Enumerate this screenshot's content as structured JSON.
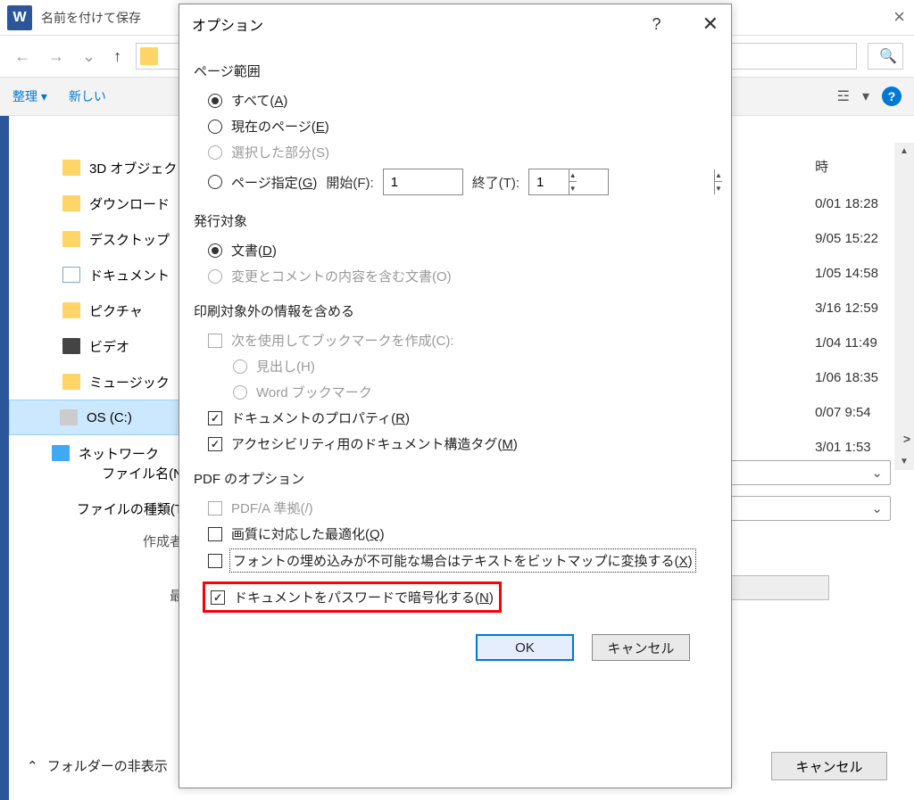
{
  "bg": {
    "title": "名前を付けて保存",
    "close_glyph": "×",
    "toolbar": {
      "organize": "整理 ▾",
      "new_folder": "新しい",
      "view_caret": "▾",
      "help": "?"
    },
    "sidebar": {
      "items": [
        {
          "label": "3D オブジェク"
        },
        {
          "label": "ダウンロード"
        },
        {
          "label": "デスクトップ"
        },
        {
          "label": "ドキュメント"
        },
        {
          "label": "ピクチャ"
        },
        {
          "label": "ビデオ"
        },
        {
          "label": "ミュージック"
        },
        {
          "label": "OS (C:)"
        },
        {
          "label": "ネットワーク"
        }
      ]
    },
    "dates_header": "時",
    "dates": [
      "0/01 18:28",
      "9/05 15:22",
      "1/05 14:58",
      "3/16 12:59",
      "1/04 11:49",
      "1/06 18:35",
      "0/07 9:54",
      "3/01 1:53"
    ],
    "form": {
      "filename_label": "ファイル名(N)",
      "filetype_label": "ファイルの種類(T)",
      "author_label": "作成者",
      "sai_label": "最"
    },
    "footer": {
      "hide_folders": "フォルダーの非表示",
      "cancel": "キャンセル"
    }
  },
  "options": {
    "title": "オプション",
    "sections": {
      "page_range": "ページ範囲",
      "publish": "発行対象",
      "include": "印刷対象外の情報を含める",
      "pdf": "PDF のオプション"
    },
    "page_range": {
      "all": {
        "pre": "すべて(",
        "u": "A",
        "post": ")"
      },
      "current": {
        "pre": "現在のページ(",
        "u": "E",
        "post": ")"
      },
      "selection": "選択した部分(S)",
      "pages": {
        "pre": "ページ指定(",
        "u": "G",
        "post": ")"
      },
      "from_label": "開始(F):",
      "to_label": "終了(T):",
      "from_value": "1",
      "to_value": "1"
    },
    "publish": {
      "document": {
        "pre": "文書(",
        "u": "D",
        "post": ")"
      },
      "with_markup": "変更とコメントの内容を含む文書(O)"
    },
    "include": {
      "bookmarks": "次を使用してブックマークを作成(C):",
      "headings": "見出し(H)",
      "word_bm": "Word ブックマーク",
      "props": {
        "pre": "ドキュメントのプロパティ(",
        "u": "R",
        "post": ")"
      },
      "a11y": {
        "pre": "アクセシビリティ用のドキュメント構造タグ(",
        "u": "M",
        "post": ")"
      }
    },
    "pdf": {
      "pdfa": "PDF/A 準拠(/)",
      "optimize": {
        "pre": "画質に対応した最適化(",
        "u": "Q",
        "post": ")"
      },
      "bitmap": {
        "pre": "フォントの埋め込みが不可能な場合はテキストをビットマップに変換する(",
        "u": "X",
        "post": ")"
      },
      "encrypt": {
        "pre": "ドキュメントをパスワードで暗号化する(",
        "u": "N",
        "post": ")"
      }
    },
    "buttons": {
      "ok": "OK",
      "cancel": "キャンセル"
    }
  }
}
